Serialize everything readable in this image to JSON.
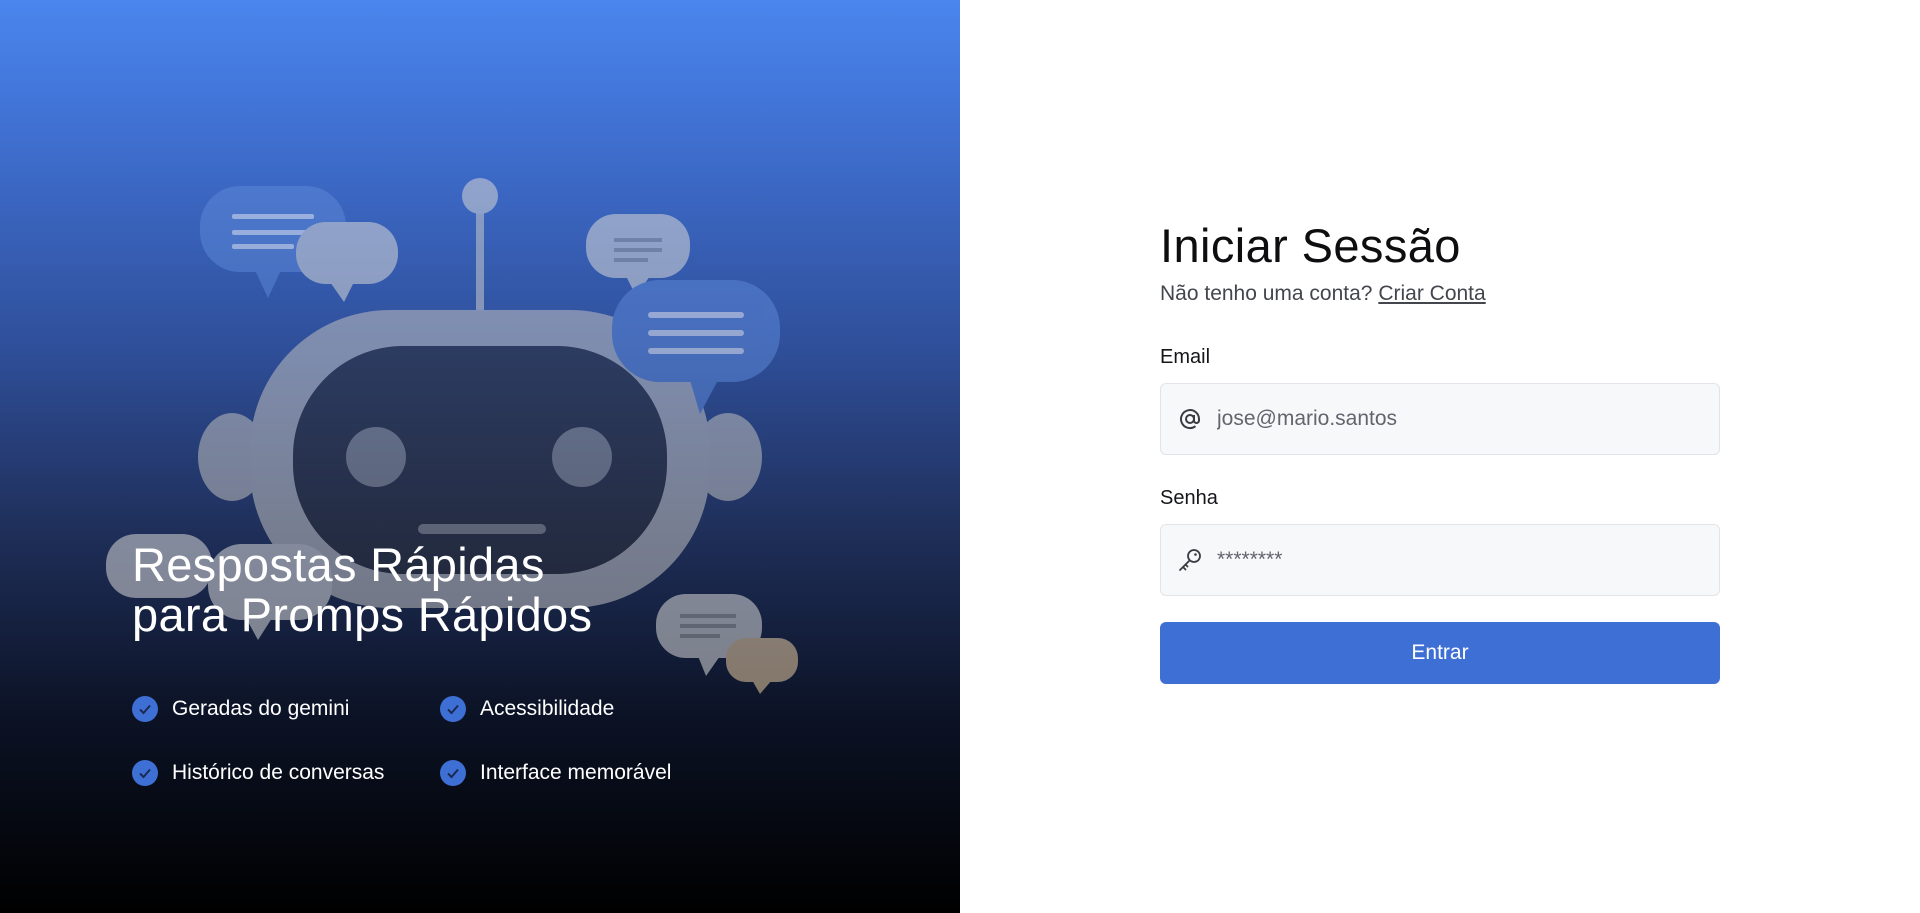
{
  "hero": {
    "title_line1": "Respostas Rápidas",
    "title_line2": "para Promps Rápidos",
    "features": [
      {
        "label": "Geradas do gemini"
      },
      {
        "label": "Acessibilidade"
      },
      {
        "label": "Histórico de conversas"
      },
      {
        "label": "Interface memorável"
      }
    ]
  },
  "login": {
    "title": "Iniciar Sessão",
    "signup_prompt": "Não tenho uma conta?",
    "signup_link": "Criar Conta",
    "email_label": "Email",
    "email_placeholder": "jose@mario.santos",
    "email_icon": "at-icon",
    "password_label": "Senha",
    "password_placeholder": "********",
    "password_icon": "key-icon",
    "submit_label": "Entrar"
  },
  "colors": {
    "accent": "#3e6fd4",
    "gradient_top": "#4a86ee",
    "gradient_bottom": "#000000"
  }
}
